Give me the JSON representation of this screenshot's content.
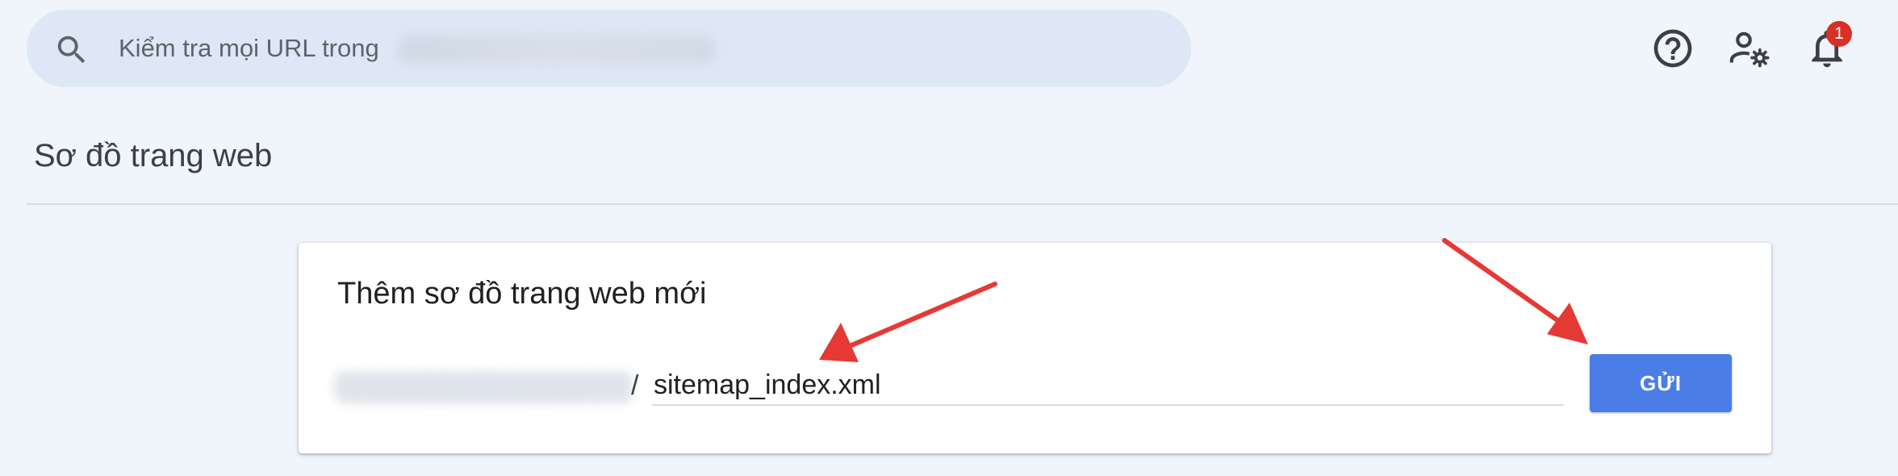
{
  "header": {
    "search": {
      "placeholder": "Kiểm tra mọi URL trong"
    },
    "icons": [
      "search-icon",
      "help-icon",
      "admin-settings-icon",
      "bell-icon"
    ],
    "notification_count": "1"
  },
  "page": {
    "title": "Sơ đồ trang web"
  },
  "card": {
    "title": "Thêm sơ đồ trang web mới",
    "url_separator": "/",
    "input_value": "sitemap_index.xml",
    "submit_label": "GỬI"
  },
  "colors": {
    "background": "#f0f4fb",
    "search_bg": "#dde7f6",
    "primary_button": "#4a7ee6",
    "badge": "#d93025",
    "annotation_arrow": "#e53935"
  }
}
